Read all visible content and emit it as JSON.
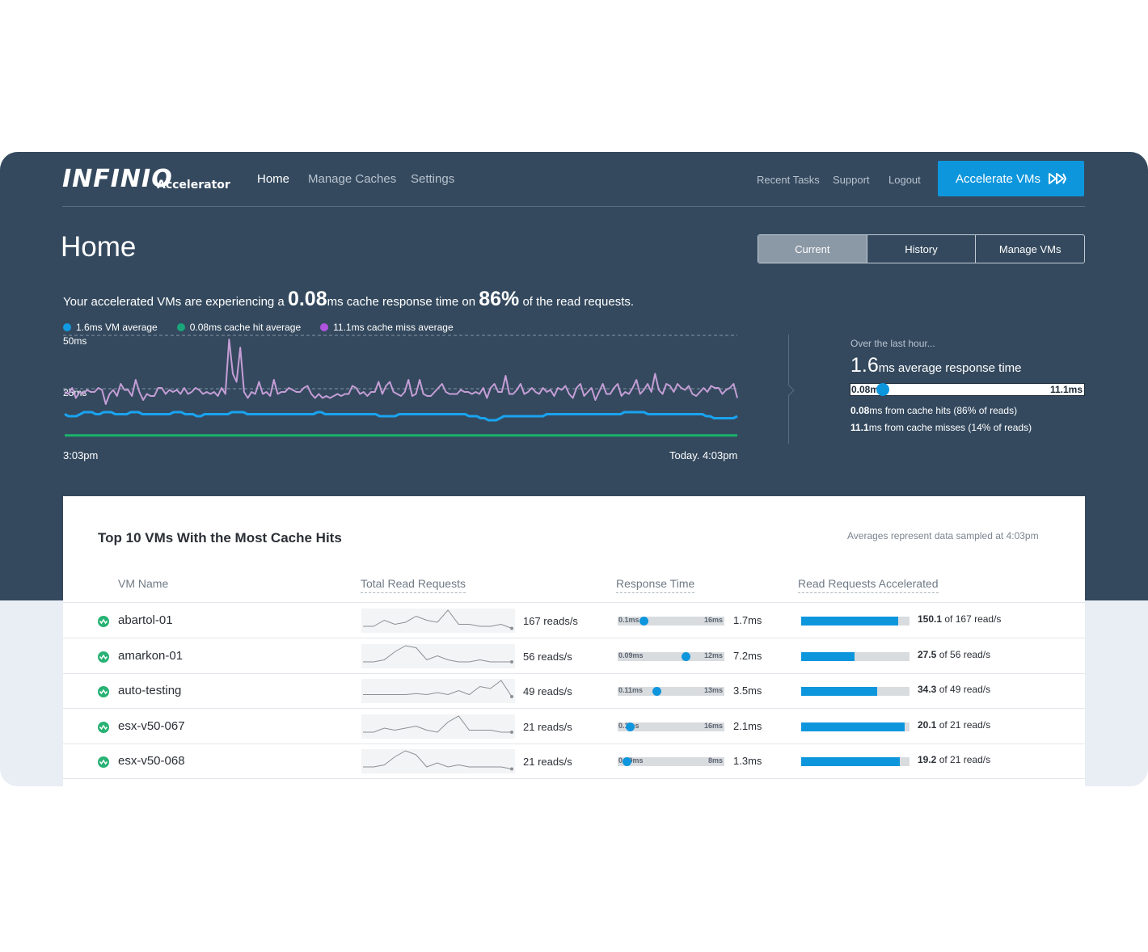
{
  "brand": {
    "name": "INFINIO",
    "product": "Accelerator"
  },
  "nav": {
    "items": [
      "Home",
      "Manage Caches",
      "Settings"
    ],
    "active": "Home"
  },
  "top_links": [
    "Recent Tasks",
    "Support",
    "Logout"
  ],
  "accelerate_button": "Accelerate VMs",
  "page_title": "Home",
  "view_tabs": [
    "Current",
    "History",
    "Manage VMs"
  ],
  "active_tab": "Current",
  "summary": {
    "prefix": "Your accelerated VMs are experiencing a",
    "response_value": "0.08",
    "response_unit": "ms cache response time on",
    "percent": "86%",
    "suffix": "of the read requests."
  },
  "legend": [
    {
      "label": "1.6ms VM average",
      "color": "#129ae2"
    },
    {
      "label": "0.08ms cache hit average",
      "color": "#1aa67a"
    },
    {
      "label": "11.1ms cache miss average",
      "color": "#b054e0"
    }
  ],
  "colors": {
    "accent": "#0e96dd",
    "header_bg": "#34495e",
    "vm_line": "#1aa3f0",
    "hit_line": "#19b36b",
    "miss_line": "#c59ed6",
    "status_green": "#27b273"
  },
  "chart_data": {
    "type": "line",
    "ylabels": [
      "50ms",
      "25ms"
    ],
    "ylim": [
      0,
      50
    ],
    "x_start_label": "3:03pm",
    "x_end_label": "Today. 4:03pm",
    "series": [
      {
        "name": "11.1ms cache miss average",
        "color": "#c59ed6",
        "values": [
          22,
          21,
          24,
          19,
          22,
          21,
          23,
          22,
          22,
          24,
          23,
          16,
          21,
          23,
          20,
          26,
          23,
          23,
          20,
          28,
          22,
          18,
          21,
          20,
          20,
          24,
          24,
          21,
          23,
          22,
          23,
          21,
          24,
          21,
          22,
          24,
          23,
          21,
          22,
          21,
          22,
          20,
          24,
          21,
          48,
          31,
          27,
          44,
          22,
          19,
          22,
          21,
          27,
          21,
          22,
          20,
          28,
          21,
          22,
          22,
          24,
          23,
          22,
          22,
          24,
          25,
          21,
          19,
          21,
          19,
          20,
          19,
          20,
          21,
          20,
          21,
          21,
          25,
          24,
          21,
          22,
          20,
          22,
          22,
          27,
          21,
          25,
          27,
          22,
          21,
          20,
          22,
          28,
          20,
          21,
          28,
          21,
          20,
          20,
          22,
          24,
          26,
          22,
          21,
          21,
          21,
          23,
          22,
          22,
          21,
          22,
          21,
          24,
          19,
          24,
          26,
          22,
          22,
          30,
          21,
          21,
          23,
          26,
          21,
          22,
          24,
          22,
          21,
          24,
          22,
          23,
          20,
          24,
          23,
          25,
          21,
          19,
          24,
          26,
          20,
          22,
          24,
          18,
          22,
          26,
          21,
          21,
          24,
          26,
          20,
          22,
          21,
          24,
          28,
          21,
          23,
          26,
          22,
          31,
          23,
          21,
          26,
          25,
          22,
          26,
          24,
          23,
          25,
          21,
          20,
          22,
          24,
          22,
          25,
          24,
          24,
          21,
          23,
          24,
          26,
          19
        ]
      },
      {
        "name": "1.6ms VM average",
        "color": "#1aa3f0",
        "values": [
          11,
          10,
          10,
          10,
          11,
          12,
          12,
          12,
          11,
          11,
          12,
          12,
          12,
          11,
          11,
          11,
          11,
          12,
          12,
          12,
          11,
          11,
          11,
          11,
          11,
          11,
          11,
          11,
          12,
          12,
          12,
          11,
          11,
          11,
          10,
          10,
          11,
          11,
          11,
          11,
          11,
          11,
          11,
          12,
          12,
          12,
          12,
          11,
          11,
          11,
          11,
          11,
          11,
          11,
          11,
          11,
          11,
          11,
          11,
          11,
          11,
          11,
          11,
          11,
          11,
          12,
          12,
          11,
          11,
          11,
          11,
          11,
          11,
          11,
          11,
          11,
          11,
          11,
          11,
          11,
          11,
          10,
          10,
          10,
          10,
          10,
          11,
          11,
          11,
          11,
          11,
          11,
          11,
          11,
          11,
          11,
          11,
          11,
          11,
          11,
          11,
          11,
          11,
          11,
          10,
          10,
          10,
          9,
          9,
          8,
          8,
          8,
          9,
          10,
          10,
          10,
          10,
          10,
          10,
          10,
          10,
          10,
          10,
          10,
          11,
          11,
          11,
          11,
          11,
          11,
          11,
          11,
          11,
          11,
          11,
          11,
          11,
          11,
          11,
          11,
          11,
          11,
          11,
          11,
          12,
          12,
          12,
          12,
          12,
          12,
          11,
          11,
          11,
          11,
          11,
          11,
          11,
          11,
          11,
          11,
          11,
          11,
          11,
          11,
          11,
          10,
          10,
          9,
          9,
          9,
          9,
          9,
          9,
          10
        ]
      },
      {
        "name": "0.08ms cache hit average",
        "color": "#19b36b",
        "values": [
          0.5,
          0.5,
          0.5,
          0.5,
          0.5,
          0.5,
          0.5,
          0.5,
          0.5,
          0.5,
          0.5,
          0.5,
          0.5,
          0.5,
          0.5,
          0.5,
          0.5,
          0.5,
          0.5,
          0.5,
          0.5,
          0.5,
          0.5,
          0.5,
          0.5,
          0.5,
          0.5,
          0.5,
          0.5,
          0.5,
          0.5,
          0.5,
          0.5,
          0.5,
          0.5,
          0.5,
          0.5,
          0.5,
          0.5,
          0.5,
          0.5,
          0.5,
          0.5,
          0.5,
          0.5,
          0.5,
          0.5,
          0.5,
          0.5,
          0.5
        ]
      }
    ]
  },
  "overview": {
    "label": "Over the last hour...",
    "value": "1.6",
    "value_text": "ms average response time",
    "bar_min": "0.08ms",
    "bar_max": "11.1ms",
    "bar_position": 0.14,
    "hit_value": "0.08",
    "hit_text": "ms from cache hits (86% of reads)",
    "miss_value": "11.1",
    "miss_text": "ms from cache misses (14% of reads)"
  },
  "table": {
    "title": "Top 10 VMs With the Most Cache Hits",
    "note": "Averages represent data sampled at 4:03pm",
    "columns": [
      "VM Name",
      "Total Read Requests",
      "Response Time",
      "Read Requests Accelerated"
    ],
    "rows": [
      {
        "name": "abartol-01",
        "reads": "167 reads/s",
        "rt_min": "0.1ms",
        "rt_max": "16ms",
        "rt_pos": 0.24,
        "rt": "1.7ms",
        "acc_fraction": 0.899,
        "acc_value": "150.1",
        "acc_text": "of 167 read/s",
        "spark": [
          0.2,
          0.2,
          0.5,
          0.3,
          0.4,
          0.7,
          0.5,
          0.4,
          1,
          0.3,
          0.3,
          0.2,
          0.2,
          0.3,
          0.1
        ]
      },
      {
        "name": "amarkon-01",
        "reads": "56 reads/s",
        "rt_min": "0.09ms",
        "rt_max": "12ms",
        "rt_pos": 0.64,
        "rt": "7.2ms",
        "acc_fraction": 0.491,
        "acc_value": "27.5",
        "acc_text": "of 56 read/s",
        "spark": [
          0.2,
          0.2,
          0.3,
          0.7,
          1,
          0.9,
          0.3,
          0.5,
          0.3,
          0.2,
          0.2,
          0.3,
          0.2,
          0.2,
          0.2
        ]
      },
      {
        "name": "auto-testing",
        "reads": "49 reads/s",
        "rt_min": "0.11ms",
        "rt_max": "13ms",
        "rt_pos": 0.36,
        "rt": "3.5ms",
        "acc_fraction": 0.704,
        "acc_value": "34.3",
        "acc_text": "of 49 read/s",
        "spark": [
          0.3,
          0.3,
          0.3,
          0.3,
          0.3,
          0.35,
          0.3,
          0.4,
          0.3,
          0.5,
          0.3,
          0.7,
          0.6,
          1,
          0.2
        ]
      },
      {
        "name": "esx-v50-067",
        "reads": "21 reads/s",
        "rt_min": "0.1ms",
        "rt_max": "16ms",
        "rt_pos": 0.11,
        "rt": "2.1ms",
        "acc_fraction": 0.957,
        "acc_value": "20.1",
        "acc_text": "of 21 read/s",
        "spark": [
          0.2,
          0.2,
          0.4,
          0.3,
          0.4,
          0.5,
          0.3,
          0.2,
          0.7,
          1,
          0.3,
          0.3,
          0.3,
          0.2,
          0.2
        ]
      },
      {
        "name": "esx-v50-068",
        "reads": "21 reads/s",
        "rt_min": "0.09ms",
        "rt_max": "8ms",
        "rt_pos": 0.08,
        "rt": "1.3ms",
        "acc_fraction": 0.914,
        "acc_value": "19.2",
        "acc_text": "of 21 read/s",
        "spark": [
          0.2,
          0.2,
          0.3,
          0.7,
          1,
          0.8,
          0.2,
          0.4,
          0.2,
          0.3,
          0.2,
          0.2,
          0.2,
          0.2,
          0.1
        ]
      }
    ]
  }
}
